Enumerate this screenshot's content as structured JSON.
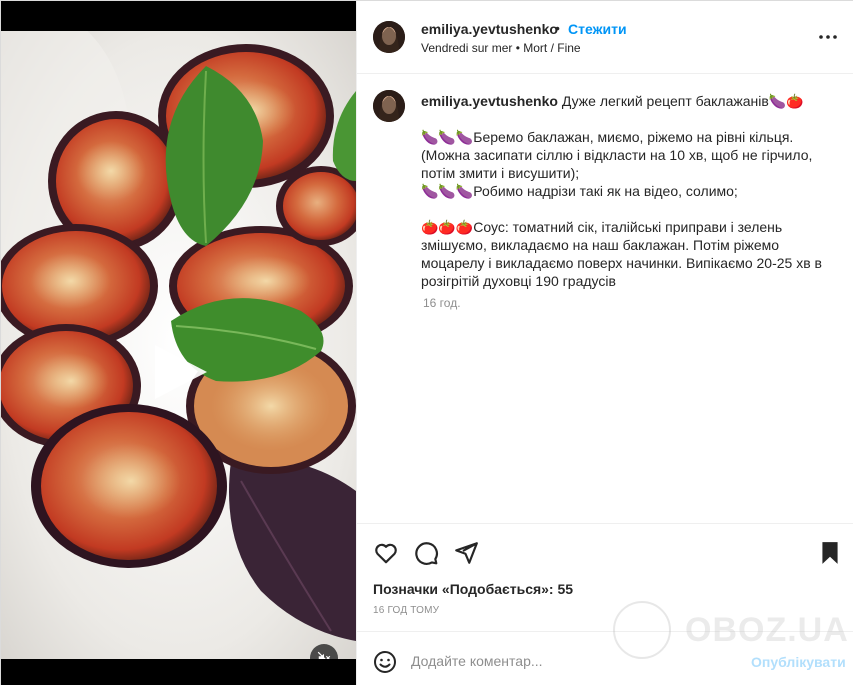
{
  "post": {
    "username": "emiliya.yevtushenko",
    "separator": "•",
    "follow_label": "Стежити",
    "audio": "Vendredi sur mer • Mort / Fine",
    "caption": {
      "line1": "Дуже легкий рецепт баклажанів🍆🍅",
      "line2": "🍆🍆🍆Беремо баклажан, миємо, ріжемо на рівні кільця. (Можна засипати сіллю і відкласти на 10 хв, щоб не гірчило, потім змити і висушити);",
      "line3": "🍆🍆🍆Робимо надрізи такі як на відео, солимо;",
      "line4": "🍅🍅🍅Соус: томатний сік, італійські приправи і зелень змішуємо, викладаємо на наш баклажан. Потім ріжемо моцарелу і викладаємо поверх начинки. Випікаємо 20-25 хв в розігрітій духовці 190 градусів"
    },
    "caption_time": "16 год.",
    "likes": "Позначки «Подобається»: 55",
    "time_ago": "16 ГОД ТОМУ"
  },
  "comment": {
    "placeholder": "Додайте коментар...",
    "post_label": "Опублікувати"
  },
  "watermark": {
    "text": "OBOZ.UA"
  },
  "icons": {
    "more": "more-horizontal-icon",
    "like": "heart-icon",
    "comment": "comment-bubble-icon",
    "share": "paper-plane-icon",
    "save": "bookmark-icon",
    "emoji": "smiley-icon",
    "play": "play-icon",
    "mute": "muted-speaker-icon"
  },
  "colors": {
    "accent": "#0095f6",
    "post_disabled": "#b2dffc",
    "text": "#262626",
    "muted": "#8e8e8e"
  }
}
